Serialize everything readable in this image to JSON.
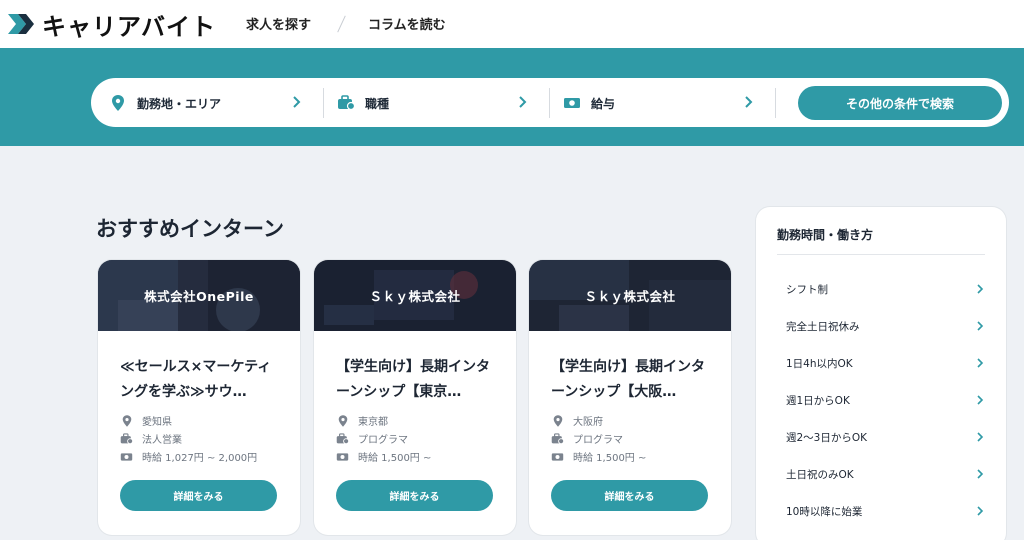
{
  "brand": {
    "name": "キャリアバイト",
    "accent": "#2f9aa6",
    "icon": "logo-chevron-icon"
  },
  "nav": {
    "find_jobs": "求人を探す",
    "read_columns": "コラムを読む"
  },
  "search": {
    "location_label": "勤務地・エリア",
    "job_type_label": "職種",
    "salary_label": "給与",
    "other_button": "その他の条件で検索"
  },
  "section": {
    "title": "おすすめインターン"
  },
  "cards": [
    {
      "company": "株式会社OnePile",
      "title": "≪セールス×マーケティングを学ぶ≫サウ…",
      "location": "愛知県",
      "job_type": "法人営業",
      "pay": "時給 1,027円 ~ 2,000円",
      "button": "詳細をみる"
    },
    {
      "company": "Ｓｋｙ株式会社",
      "title": "【学生向け】長期インターンシップ【東京…",
      "location": "東京都",
      "job_type": "プログラマ",
      "pay": "時給 1,500円 ~",
      "button": "詳細をみる"
    },
    {
      "company": "Ｓｋｙ株式会社",
      "title": "【学生向け】長期インターンシップ【大阪…",
      "location": "大阪府",
      "job_type": "プログラマ",
      "pay": "時給 1,500円 ~",
      "button": "詳細をみる"
    }
  ],
  "sidebar": {
    "title": "勤務時間・働き方",
    "items": [
      "シフト制",
      "完全土日祝休み",
      "1日4h以内OK",
      "週1日からOK",
      "週2～3日からOK",
      "土日祝のみOK",
      "10時以降に始業"
    ]
  }
}
